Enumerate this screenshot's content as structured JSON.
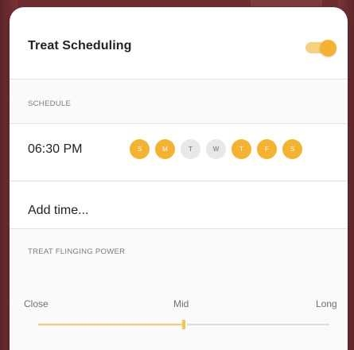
{
  "settings": {
    "treat_scheduling": {
      "label": "Treat Scheduling",
      "enabled": true
    },
    "schedule": {
      "header": "SCHEDULE",
      "time": "06:30 PM",
      "days": [
        {
          "letter": "S",
          "selected": true
        },
        {
          "letter": "M",
          "selected": true
        },
        {
          "letter": "T",
          "selected": false
        },
        {
          "letter": "W",
          "selected": false
        },
        {
          "letter": "T",
          "selected": true
        },
        {
          "letter": "F",
          "selected": true
        },
        {
          "letter": "S",
          "selected": true
        }
      ],
      "add_time": "Add time..."
    },
    "power": {
      "header": "TREAT FLINGING POWER",
      "labels": {
        "close": "Close",
        "mid": "Mid",
        "long": "Long"
      },
      "value": 0.5
    }
  },
  "colors": {
    "accent": "#f5b230",
    "accent_light": "#f6d27e",
    "background": "#6e2e30"
  }
}
